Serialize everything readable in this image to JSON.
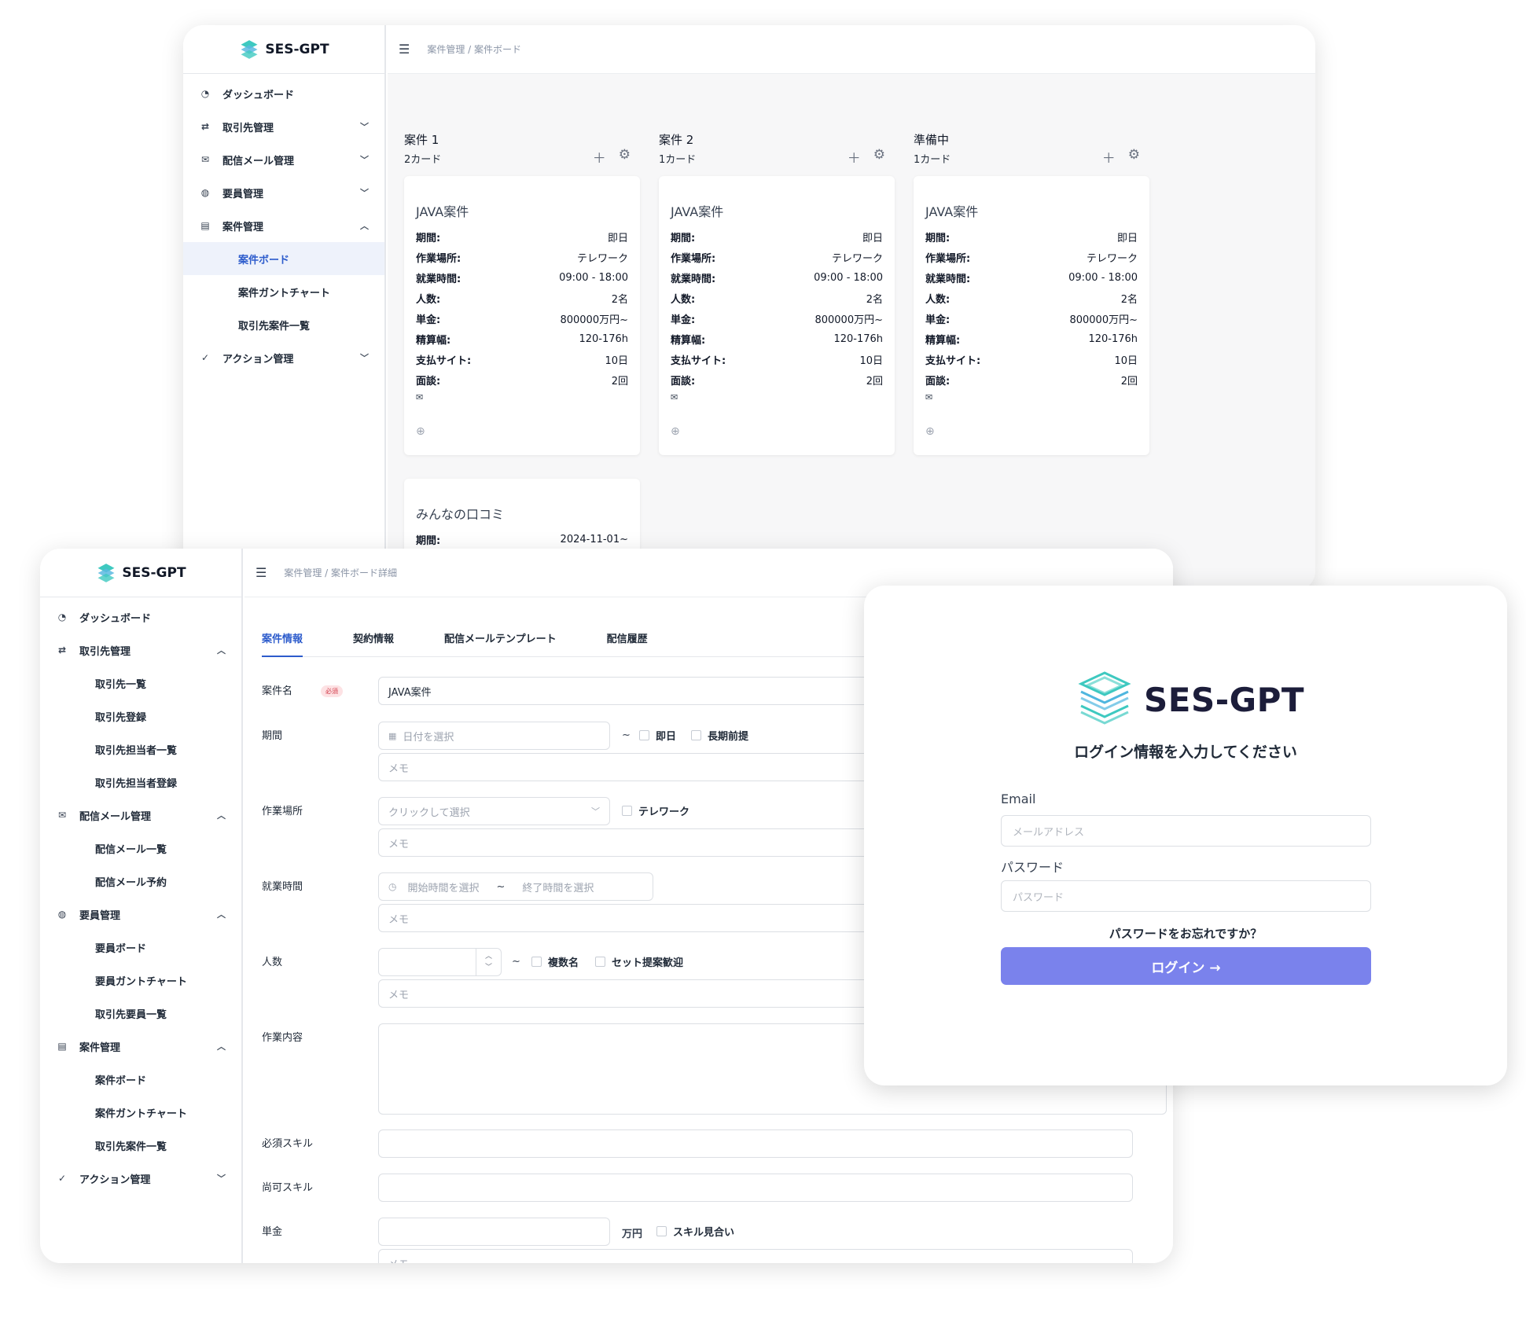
{
  "brand": {
    "name": "SES-GPT"
  },
  "board_window": {
    "breadcrumb": "案件管理  /  案件ボード",
    "nav": {
      "dashboard": "ダッシュボード",
      "clients": "取引先管理",
      "mail": "配信メール管理",
      "staff": "要員管理",
      "projects": "案件管理",
      "project_board": "案件ボード",
      "project_gantt": "案件ガントチャート",
      "client_projects": "取引先案件一覧",
      "actions": "アクション管理"
    },
    "columns": [
      {
        "title": "案件 1",
        "count": "2カード"
      },
      {
        "title": "案件 2",
        "count": "1カード"
      },
      {
        "title": "準備中",
        "count": "1カード"
      }
    ],
    "card": {
      "title": "JAVA案件",
      "rows": [
        {
          "k": "期間:",
          "v": "即日"
        },
        {
          "k": "作業場所:",
          "v": "テレワーク"
        },
        {
          "k": "就業時間:",
          "v": "09:00 - 18:00"
        },
        {
          "k": "人数:",
          "v": "2名"
        },
        {
          "k": "単金:",
          "v": "800000万円~"
        },
        {
          "k": "精算幅:",
          "v": "120-176h"
        },
        {
          "k": "支払サイト:",
          "v": "10日"
        },
        {
          "k": "面談:",
          "v": "2回"
        }
      ]
    },
    "second_card": {
      "title": "みんなの口コミ",
      "k": "期間:",
      "v": "2024-11-01~"
    }
  },
  "detail_window": {
    "breadcrumb": "案件管理  /  案件ボード詳細",
    "nav": {
      "dashboard": "ダッシュボード",
      "clients": "取引先管理",
      "client_list": "取引先一覧",
      "client_register": "取引先登録",
      "client_contact_list": "取引先担当者一覧",
      "client_contact_register": "取引先担当者登録",
      "mail": "配信メール管理",
      "mail_list": "配信メール一覧",
      "mail_schedule": "配信メール予約",
      "staff": "要員管理",
      "staff_board": "要員ボード",
      "staff_gantt": "要員ガントチャート",
      "client_staff_list": "取引先要員一覧",
      "projects": "案件管理",
      "project_board": "案件ボード",
      "project_gantt": "案件ガントチャート",
      "client_projects": "取引先案件一覧",
      "actions": "アクション管理"
    },
    "tabs": [
      "案件情報",
      "契約情報",
      "配信メールテンプレート",
      "配信履歴"
    ],
    "form": {
      "name_label": "案件名",
      "required_badge": "必須",
      "name_value": "JAVA案件",
      "period_label": "期間",
      "date_placeholder": "日付を選択",
      "tilde": "~",
      "immediate": "即日",
      "long_term": "長期前提",
      "memo": "メモ",
      "location_label": "作業場所",
      "location_placeholder": "クリックして選択",
      "telework": "テレワーク",
      "hours_label": "就業時間",
      "start_placeholder": "開始時間を選択",
      "end_placeholder": "終了時間を選択",
      "headcount_label": "人数",
      "multiple": "複数名",
      "set_proposal": "セット提案歓迎",
      "work_label": "作業内容",
      "required_skill_label": "必須スキル",
      "optional_skill_label": "尚可スキル",
      "price_label": "単金",
      "price_unit": "万円",
      "skill_match": "スキル見合い"
    }
  },
  "login_window": {
    "subtitle": "ログイン情報を入力してください",
    "email_label": "Email",
    "email_placeholder": "メールアドレス",
    "password_label": "パスワード",
    "password_placeholder": "パスワード",
    "forgot": "パスワードをお忘れですか？",
    "button": "ログイン →"
  },
  "colors": {
    "accent": "#2d5ccc",
    "login_button": "#7a82ec",
    "brand_teal": "#3ec9c0"
  }
}
